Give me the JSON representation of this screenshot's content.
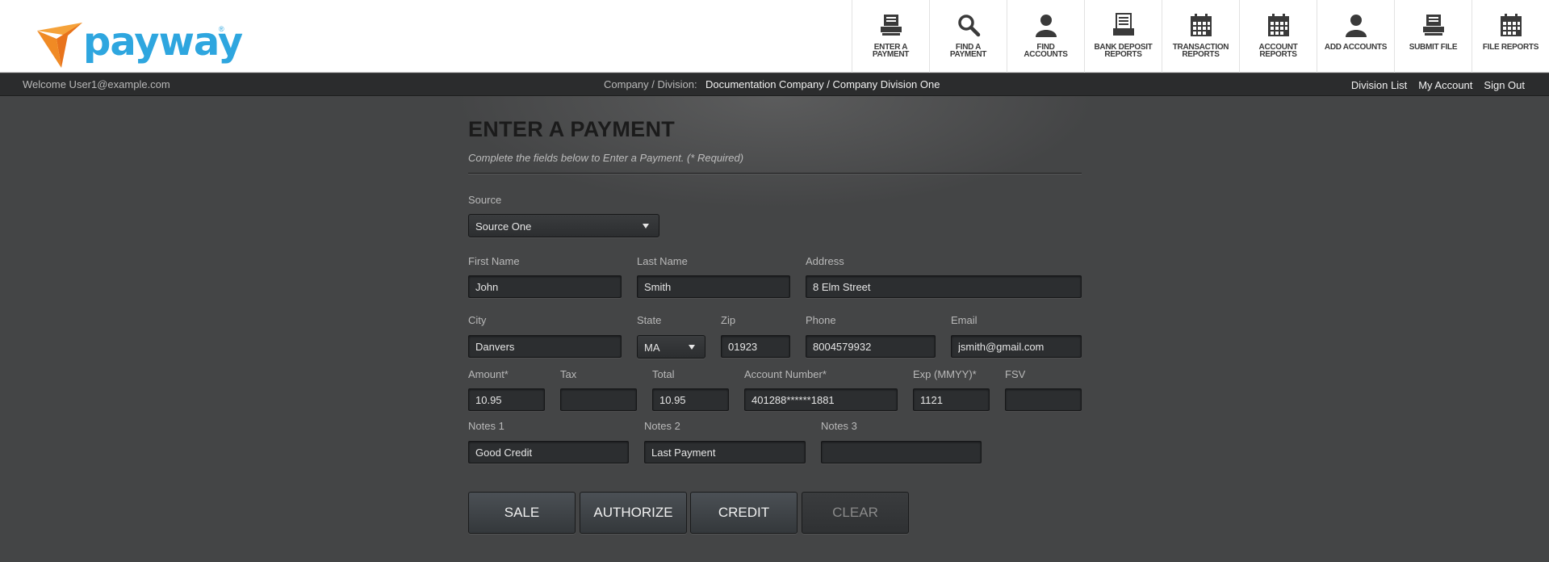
{
  "header": {
    "logo_text": "payway",
    "logo_mark": "®",
    "nav": [
      {
        "label": "ENTER A\nPAYMENT",
        "icon": "printer-icon"
      },
      {
        "label": "FIND A\nPAYMENT",
        "icon": "magnifier-icon"
      },
      {
        "label": "FIND\nACCOUNTS",
        "icon": "person-icon"
      },
      {
        "label": "BANK DEPOSIT\nREPORTS",
        "icon": "report-stack-icon"
      },
      {
        "label": "TRANSACTION\nREPORTS",
        "icon": "calendar-icon"
      },
      {
        "label": "ACCOUNT\nREPORTS",
        "icon": "calendar-icon"
      },
      {
        "label": "ADD ACCOUNTS",
        "icon": "person-icon"
      },
      {
        "label": "SUBMIT FILE",
        "icon": "printer-icon"
      },
      {
        "label": "FILE REPORTS",
        "icon": "calendar-icon"
      }
    ]
  },
  "subbar": {
    "welcome": "Welcome User1@example.com",
    "company_label": "Company / Division:",
    "company_value": "Documentation Company / Company Division One",
    "links": [
      "Division List",
      "My Account",
      "Sign Out"
    ]
  },
  "page": {
    "title": "ENTER A PAYMENT",
    "subtitle": "Complete the fields below to Enter a Payment. (* Required)"
  },
  "form": {
    "source": {
      "label": "Source",
      "value": "Source One"
    },
    "first_name": {
      "label": "First Name",
      "value": "John"
    },
    "last_name": {
      "label": "Last Name",
      "value": "Smith"
    },
    "address": {
      "label": "Address",
      "value": "8 Elm Street"
    },
    "city": {
      "label": "City",
      "value": "Danvers"
    },
    "state": {
      "label": "State",
      "value": "MA"
    },
    "zip": {
      "label": "Zip",
      "value": "01923"
    },
    "phone": {
      "label": "Phone",
      "value": "8004579932"
    },
    "email": {
      "label": "Email",
      "value": "jsmith@gmail.com"
    },
    "amount": {
      "label": "Amount*",
      "value": "10.95"
    },
    "tax": {
      "label": "Tax",
      "value": ""
    },
    "total": {
      "label": "Total",
      "value": "10.95"
    },
    "account_number": {
      "label": "Account Number*",
      "value": "401288******1881"
    },
    "exp": {
      "label": "Exp (MMYY)*",
      "value": "1121"
    },
    "fsv": {
      "label": "FSV",
      "value": ""
    },
    "notes1": {
      "label": "Notes 1",
      "value": "Good Credit"
    },
    "notes2": {
      "label": "Notes 2",
      "value": "Last Payment"
    },
    "notes3": {
      "label": "Notes 3",
      "value": ""
    }
  },
  "buttons": {
    "sale": "SALE",
    "authorize": "AUTHORIZE",
    "credit": "CREDIT",
    "clear": "CLEAR"
  },
  "colors": {
    "brand_blue": "#2ea6df",
    "brand_orange": "#f08a24",
    "background": "#444546"
  }
}
